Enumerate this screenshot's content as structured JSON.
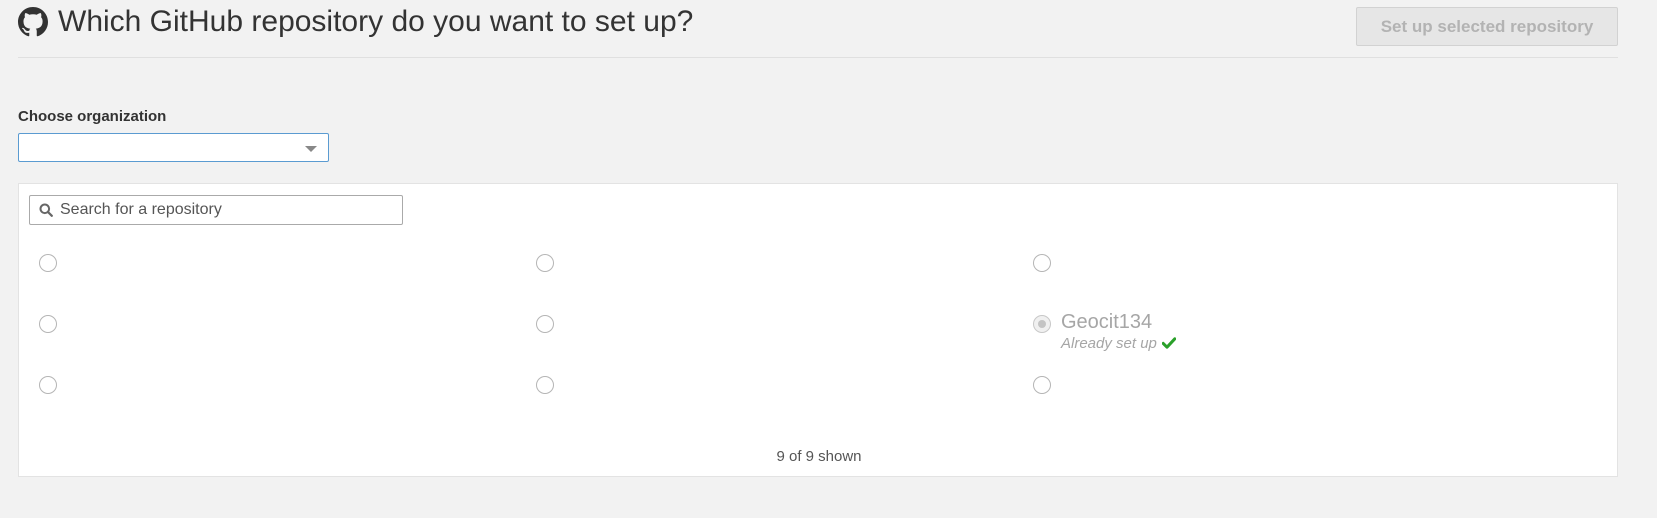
{
  "header": {
    "title": "Which GitHub repository do you want to set up?",
    "setup_button_label": "Set up selected repository",
    "icon": "github-icon"
  },
  "organization": {
    "label": "Choose organization",
    "selected": ""
  },
  "search": {
    "placeholder": "Search for a repository",
    "value": "",
    "icon": "search-icon"
  },
  "repositories": [
    {
      "name": "",
      "status": ""
    },
    {
      "name": "",
      "status": ""
    },
    {
      "name": "",
      "status": ""
    },
    {
      "name": "",
      "status": ""
    },
    {
      "name": "",
      "status": ""
    },
    {
      "name": "Geocit134",
      "status": "Already set up",
      "disabled": true
    },
    {
      "name": "",
      "status": ""
    },
    {
      "name": "",
      "status": ""
    },
    {
      "name": "",
      "status": ""
    }
  ],
  "footer": {
    "shown_count": "9 of 9 shown"
  },
  "colors": {
    "background": "#f2f2f2",
    "panel": "#ffffff",
    "select_border": "#5b9bd1",
    "check": "#2aa02a",
    "disabled_text": "#a6a6a6"
  }
}
